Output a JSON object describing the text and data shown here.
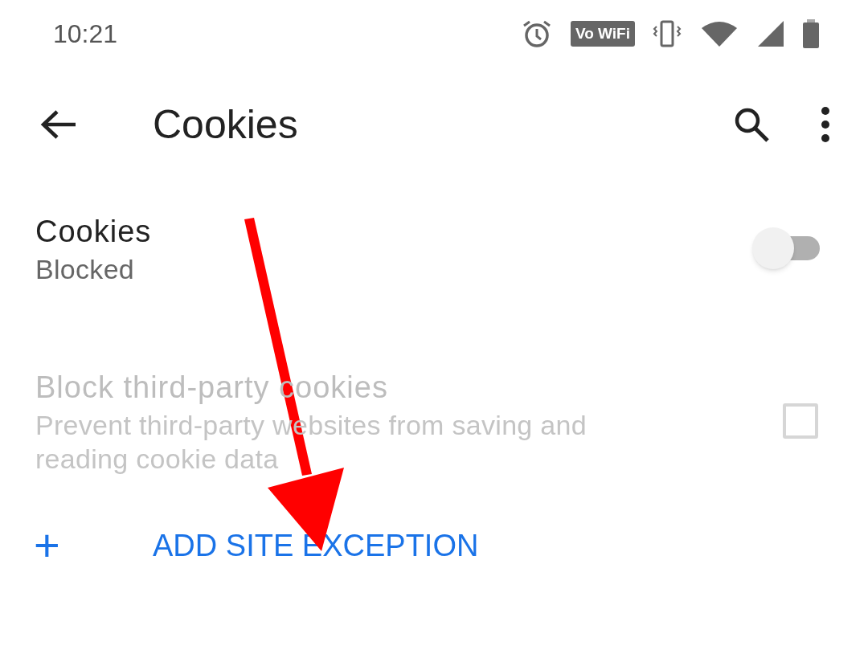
{
  "status_bar": {
    "time": "10:21",
    "wifi_calling_badge": "Vo WiFi"
  },
  "toolbar": {
    "title": "Cookies"
  },
  "settings": [
    {
      "kind": "toggle",
      "title": "Cookies",
      "summary": "Blocked",
      "on": false,
      "disabled": false
    },
    {
      "kind": "checkbox",
      "title": "Block third-party cookies",
      "summary": "Prevent third-party websites from saving and reading cookie data",
      "checked": false,
      "disabled": true
    }
  ],
  "add_button": {
    "icon": "+",
    "label": "ADD SITE EXCEPTION"
  }
}
